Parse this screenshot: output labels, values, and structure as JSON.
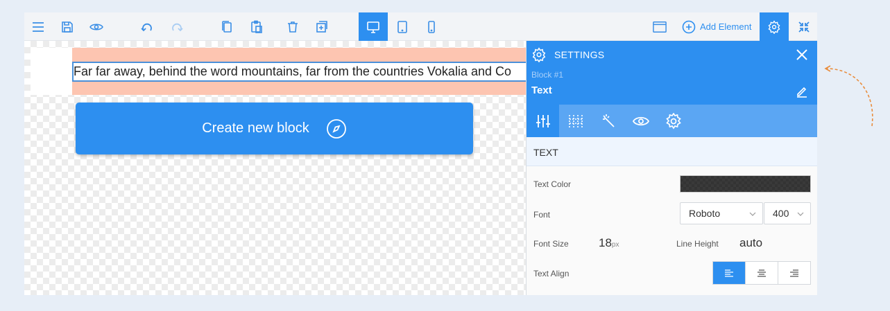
{
  "toolbar": {
    "icons": [
      "menu-icon",
      "save-icon",
      "preview-icon",
      "undo-icon",
      "redo-icon",
      "copy-icon",
      "paste-icon",
      "delete-icon",
      "add-block-icon",
      "desktop-icon",
      "tablet-icon",
      "mobile-icon",
      "window-icon"
    ],
    "add_element_label": "Add Element",
    "active_device": "desktop"
  },
  "canvas": {
    "block_text": "Far far away, behind the word mountains, far from the countries Vokalia and Co",
    "create_button_label": "Create new block"
  },
  "settings": {
    "title": "SETTINGS",
    "block_label": "Block #1",
    "element_name": "Text",
    "tabs": [
      "sliders",
      "grid",
      "magic",
      "visibility",
      "settings"
    ],
    "active_tab": "sliders",
    "section_title": "TEXT",
    "text_color_label": "Text Color",
    "text_color": "#3a3a3a",
    "font_label": "Font",
    "font_value": "Roboto",
    "weight_value": "400",
    "font_size_label": "Font Size",
    "font_size_value": "18",
    "font_size_unit": "px",
    "line_height_label": "Line Height",
    "line_height_value": "auto",
    "text_align_label": "Text Align",
    "text_align_value": "left"
  },
  "colors": {
    "accent": "#2d8ff0",
    "block_background": "#fdc5b1",
    "arrow": "#e98d3d"
  }
}
